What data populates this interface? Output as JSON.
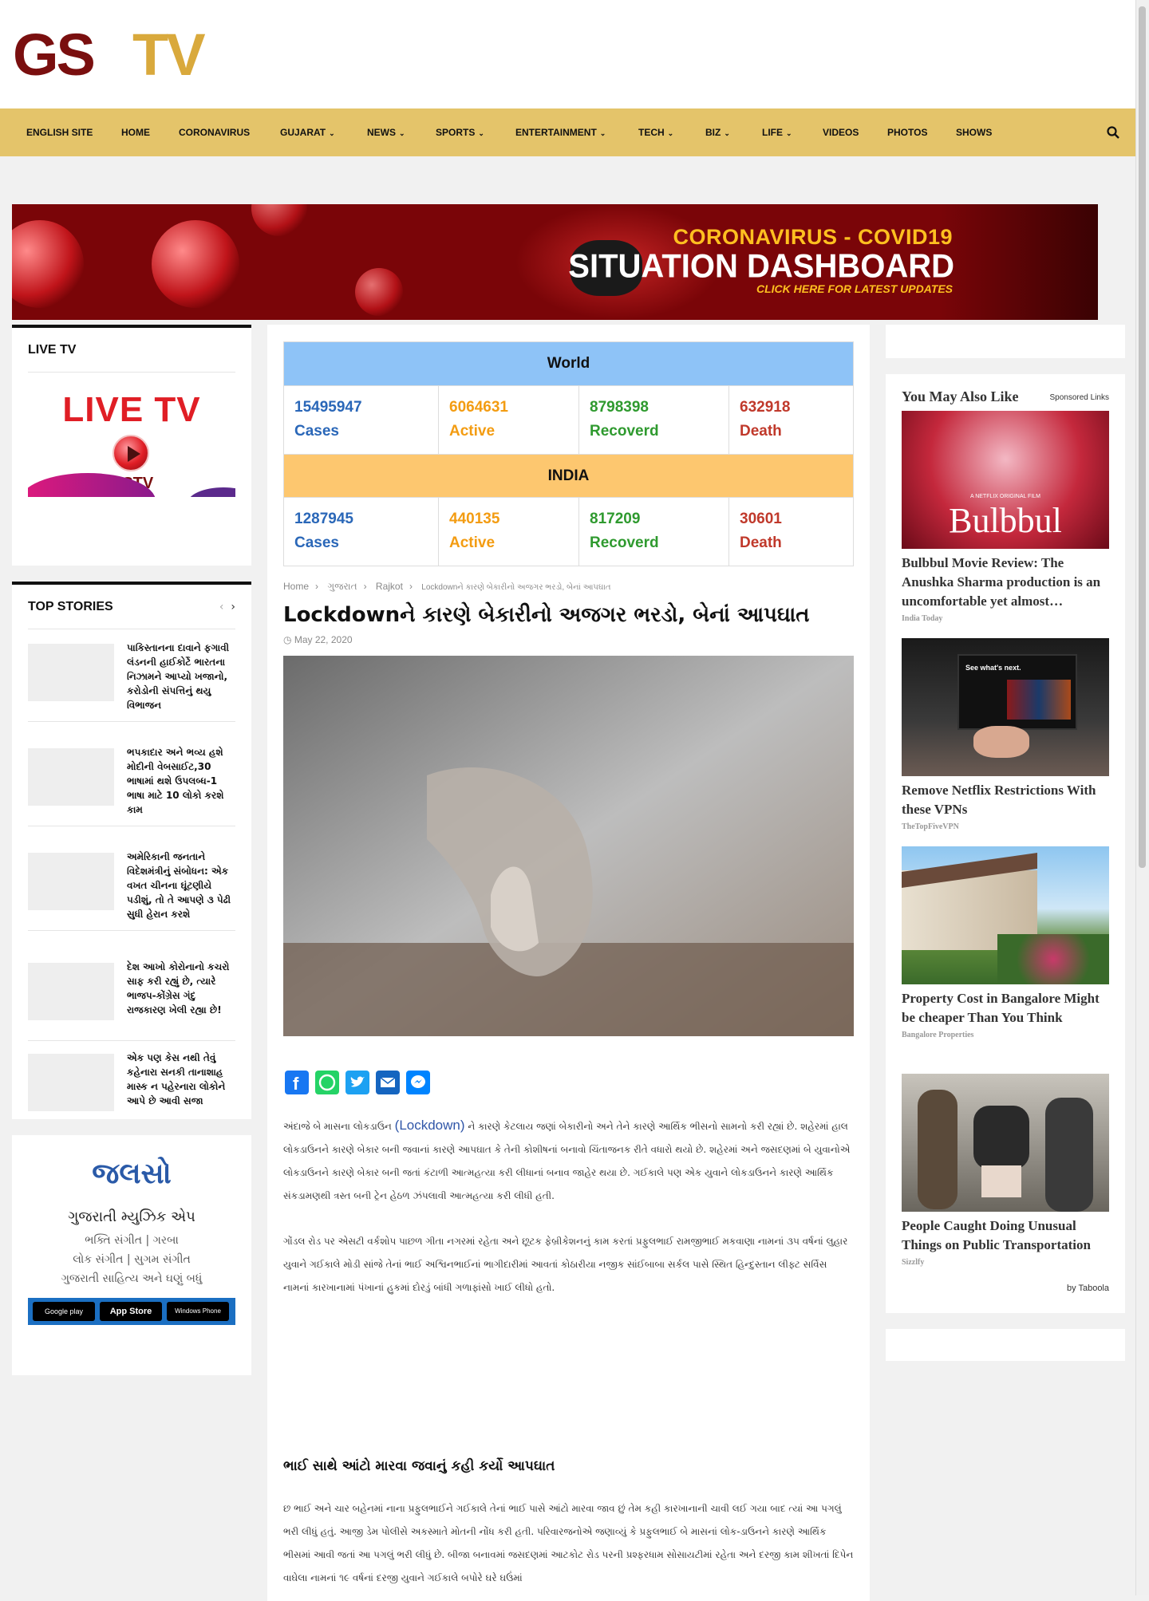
{
  "brand": {
    "logo": "GSTV",
    "colors": {
      "nav_bg": "#e4c46a",
      "logo_red": "#7a0f0f",
      "logo_gold": "#d9a93c"
    }
  },
  "nav": {
    "items": [
      {
        "label": "ENGLISH SITE",
        "has_dropdown": false
      },
      {
        "label": "HOME",
        "has_dropdown": false
      },
      {
        "label": "CORONAVIRUS",
        "has_dropdown": false
      },
      {
        "label": "GUJARAT",
        "has_dropdown": true
      },
      {
        "label": "NEWS",
        "has_dropdown": true
      },
      {
        "label": "SPORTS",
        "has_dropdown": true
      },
      {
        "label": "ENTERTAINMENT",
        "has_dropdown": true
      },
      {
        "label": "TECH",
        "has_dropdown": true
      },
      {
        "label": "BIZ",
        "has_dropdown": true
      },
      {
        "label": "LIFE",
        "has_dropdown": true
      },
      {
        "label": "VIDEOS",
        "has_dropdown": false
      },
      {
        "label": "PHOTOS",
        "has_dropdown": false
      },
      {
        "label": "SHOWS",
        "has_dropdown": false
      }
    ],
    "search_icon": "search-icon"
  },
  "banner": {
    "line1": "CORONAVIRUS - COVID19",
    "line2": "SITUATION DASHBOARD",
    "line3": "CLICK HERE FOR LATEST UPDATES"
  },
  "live_widget": {
    "title": "LIVE TV",
    "image_text": "LIVE TV",
    "image_logo": "GSTV"
  },
  "top_stories": {
    "title": "TOP STORIES",
    "items": [
      {
        "title": "પાકિસ્તાનના દાવાને ફગાવી લંડનની હાઈકોર્ટે ભારતના નિઝામને આપ્યો ખજાનો, કરોડોની સંપત્તિનું થયુ વિભાજન"
      },
      {
        "title": "ભપકાદાર અને ભવ્ય હશે મોદીની વેબસાઈટ,30 ભાષામાં થશે ઉપલબ્ધ-1 ભાષા માટે 10 લોકો કરશે કામ"
      },
      {
        "title": "અમેરિકાની જનતાને વિદેશમંત્રીનું સંબોધન: એક વખત ચીનના ઘૂંટણીયે પડીશું, તો તે આપણે ૩ પેઢી સુધી હેરાન કરશે"
      },
      {
        "title": "દેશ આખો કોરોનાનો કચરો સાફ કરી રહ્યું છે, ત્યારે ભાજપ-કોંગ્રેસ ગંદુ રાજકારણ ખેલી રહ્યા છે!"
      },
      {
        "title": "એક પણ કેસ નથી તેવું કહેનારા સનકી તાનાશાહ માસ્ક ન પહેરનારા લોકોને આપે છે આવી સજા"
      }
    ]
  },
  "music_widget": {
    "logo": "જલસો",
    "title": "ગુજરાતી મ્યુઝિક એપ",
    "line1": "ભક્તિ સંગીત | ગરબા",
    "line2": "લોક સંગીત | સુગમ સંગીત",
    "line3": "ગુજરાતી સાહિત્ય અને ઘણું બધું",
    "stores": [
      "Google play",
      "App Store",
      "Windows Phone"
    ]
  },
  "covid": {
    "world": {
      "label": "World",
      "cases": "15495947",
      "active": "6064631",
      "recovered": "8798398",
      "death": "632918"
    },
    "india": {
      "label": "INDIA",
      "cases": "1287945",
      "active": "440135",
      "recovered": "817209",
      "death": "30601"
    },
    "labels": {
      "cases": "Cases",
      "active": "Active",
      "recovered": "Recoverd",
      "death": "Death"
    },
    "colors": {
      "world_bg": "#8ec3f7",
      "india_bg": "#fdc76f",
      "cases": "#2a67b8",
      "active": "#f39c12",
      "recovered": "#2f9a2f",
      "death": "#c0392b"
    }
  },
  "article": {
    "breadcrumb": [
      "Home",
      "ગુજરાત",
      "Rajkot",
      "Lockdownને કારણે બેકારીનો અજગર ભરડો, બેનાં આપઘાત"
    ],
    "title": "Lockdownને કારણે બેકારીનો અજગર ભરડો, બેનાં આપઘાત",
    "date": "May 22, 2020",
    "share": [
      "facebook-icon",
      "whatsapp-icon",
      "twitter-icon",
      "email-icon",
      "messenger-icon"
    ],
    "p1_pre": "અંદાજે બે માસના લોકડાઉન ",
    "p1_link": "(Lockdown)",
    "p1_post": " ને કારણે કેટલાય જણાં બેકારીનો અને તેને કારણે આર્થિક ભીસનો સામનો કરી રહ્યાં છે. શહેરમાં હાલ લોકડાઉનને કારણે બેકાર બની જવાનાં કારણે આપઘાત કે તેની કોશીષનાં બનાવો ચિંતાજનક રીતે વધારો થયો છે. શહેરમાં અને જસદણમાં બે યુવાનોએ લોકડાઉનને કારણે બેકાર બની જતાં કંટાળી આત્મહત્યા કરી લીધાનાં બનાવ જાહેર થયા છે. ગઈકાલે પણ એક યુવાને લોકડાઉનને કારણે આર્થિક સંકડામણથી ત્રસ્ત બની ટ્રેન હેઠળ ઝંપલાવી આત્મહત્યા કરી લીધી હતી.",
    "p2": "ગોંડલ રોડ પર એસટી વર્કશોપ પાછળ ગીતા નગરમાં રહેતા અને છૂટક ફેબ્રીકેશનનું કામ કરતાં પ્રફુલભાઈ રામજીભાઈ મકવાણા નામનાં ૩૫ વર્ષનાં લુહાર યુવાને ગઈકાલે મોડી સાંજે તેનાં ભાઈ અશ્વિનભાઈનાં ભાગીદારીમાં આવતાં કોઠારીયા નજીક સાંઈબાબા સર્કલ પાસે સ્થિત હિન્દુસ્તાન લીફ્ટ સર્વિસ નામનાં કારખાનામાં પંખાનાં હુકમાં દોરડું બાંધી ગળાફાંસો ખાઈ લીધો હતો.",
    "subhead": "ભાઈ સાથે આંટો મારવા જવાનું કહી કર્યો આપઘાત",
    "p3": "છ ભાઈ અને ચાર બહેનમાં નાના પ્રફુલભાઈને ગઈકાલે તેનાં ભાઈ પાસે આંટો મારવા જાવ છું તેમ કહી કારખાનાની ચાવી લઈ ગયા બાદ ત્યાં આ પગલું ભરી લીધું હતું. આજી ડેમ પોલીસે અકસ્માતે મોતની નોંધ કરી હતી. પરિવારજનોએ જણાવ્યું કે પ્રફુલભાઈ બે માસનાં લોક-ડાઉનને કારણે આર્થિક ભીસમાં આવી જતાં આ પગલું ભરી લીધું છે. બીજા બનાવમાં જસદણમાં આટકોટ રોડ પરની પ્રશ્ફરધામ સોસાયટીમાં રહેતા અને દરજી કામ શીખતાં દિપેન વાઘેલા નામનાં ૧૯ વર્ષનાં દરજી યુવાને ગઈકાલે બપોરે ઘરે ઘઉંમાં"
  },
  "taboola": {
    "heading": "You May Also Like",
    "sponsored": "Sponsored Links",
    "footer": "by Taboola",
    "items": [
      {
        "title": "Bulbbul Movie Review: The Anushka Sharma production is an uncomfortable yet almost…",
        "source": "India Today",
        "image_text": "Bulbbul",
        "image_caption": "A NETFLIX ORIGINAL FILM"
      },
      {
        "title": "Remove Netflix Restrictions With these VPNs",
        "source": "TheTopFiveVPN",
        "image_text": "See what's next."
      },
      {
        "title": "Property Cost in Bangalore Might be cheaper Than You Think",
        "source": "Bangalore Properties"
      },
      {
        "title": "People Caught Doing Unusual Things on Public Transportation",
        "source": "Sizzlfy"
      }
    ]
  }
}
